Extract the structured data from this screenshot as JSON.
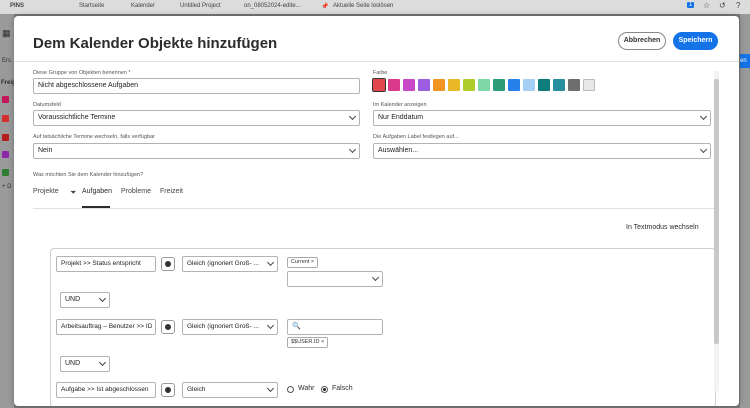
{
  "topbar": {
    "pins": "PINS",
    "crumb1": "Startseite",
    "crumb2": "Kalender",
    "crumb3": "Untitled Project",
    "crumb4": "on_08052024-edite...",
    "unpin": "Aktuelle Seite loslösen",
    "badge": "1"
  },
  "bg": {
    "first_tab": "Ers",
    "left_label": "Freig",
    "plus_label": "+ D",
    "right_label": "en"
  },
  "modal": {
    "title": "Dem Kalender Objekte hinzufügen",
    "cancel": "Abbrechen",
    "save": "Speichern"
  },
  "form": {
    "name_label": "Diese Gruppe von Objekten benennen *",
    "name_value": "Nicht abgeschlossene Aufgaben",
    "color_label": "Farbe",
    "colors": [
      "#e34850",
      "#d93a8c",
      "#c948c7",
      "#9c5de0",
      "#f29423",
      "#e9b826",
      "#b0cc2b",
      "#7ed7a6",
      "#2d9d78",
      "#2680eb",
      "#a6cff5",
      "#0f7d7d",
      "#268e9c",
      "#6e6e6e",
      "#e8e8e8"
    ],
    "date_label": "Datumsfeld",
    "date_value": "Voraussichtliche Termine",
    "show_label": "Im Kalender anzeigen",
    "show_value": "Nur Enddatum",
    "switch_label": "Auf tatsächliche Termine wechseln, falls verfügbar",
    "switch_value": "Nein",
    "label_label": "Die Aufgaben Label festlegen auf...",
    "label_value": "Auswählen...",
    "question": "Was möchten Sie dem Kalender hinzufügen?"
  },
  "tabs": [
    "Projekte",
    "Aufgaben",
    "Probleme",
    "Freizeit"
  ],
  "text_mode": "In Textmodus wechseln",
  "filters": {
    "row1_field": "Projekt  >>  Status entspricht",
    "row1_op": "Gleich (ignoriert Groß- ...",
    "row1_chip": "Current",
    "and1": "UND",
    "row2_field": "Arbeitsauftrag – Benutzer  >>  ID",
    "row2_op": "Gleich (ignoriert Groß- ...",
    "row2_chip": "$$USER.ID",
    "and2": "UND",
    "row3_field": "Aufgabe  >>  Ist abgeschlossen",
    "row3_op": "Gleich",
    "true_label": "Wahr",
    "false_label": "Falsch"
  }
}
